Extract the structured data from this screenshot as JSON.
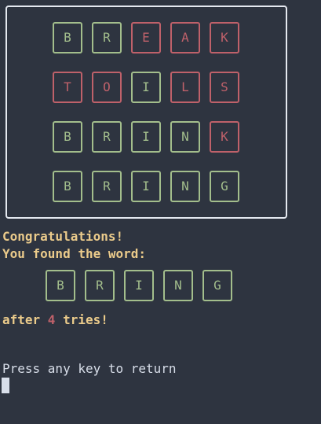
{
  "board": {
    "rows": [
      {
        "letters": [
          {
            "ch": "B",
            "state": "ok"
          },
          {
            "ch": "R",
            "state": "ok"
          },
          {
            "ch": "E",
            "state": "wrong"
          },
          {
            "ch": "A",
            "state": "wrong"
          },
          {
            "ch": "K",
            "state": "wrong"
          }
        ]
      },
      {
        "letters": [
          {
            "ch": "T",
            "state": "wrong"
          },
          {
            "ch": "O",
            "state": "wrong"
          },
          {
            "ch": "I",
            "state": "ok"
          },
          {
            "ch": "L",
            "state": "wrong"
          },
          {
            "ch": "S",
            "state": "wrong"
          }
        ]
      },
      {
        "letters": [
          {
            "ch": "B",
            "state": "ok"
          },
          {
            "ch": "R",
            "state": "ok"
          },
          {
            "ch": "I",
            "state": "ok"
          },
          {
            "ch": "N",
            "state": "ok"
          },
          {
            "ch": "K",
            "state": "wrong"
          }
        ]
      },
      {
        "letters": [
          {
            "ch": "B",
            "state": "ok"
          },
          {
            "ch": "R",
            "state": "ok"
          },
          {
            "ch": "I",
            "state": "ok"
          },
          {
            "ch": "N",
            "state": "ok"
          },
          {
            "ch": "G",
            "state": "ok"
          }
        ]
      }
    ]
  },
  "result": {
    "congrats": "Congratulations!",
    "found": "You found the word:",
    "word": [
      "B",
      "R",
      "I",
      "N",
      "G"
    ],
    "after_prefix": "after ",
    "tries_count": "4",
    "after_suffix": " tries!"
  },
  "footer": {
    "prompt": "Press any key to return"
  },
  "colors": {
    "background": "#2e3440",
    "correct": "#a3be8c",
    "wrong": "#bf616a",
    "message": "#ebcb8b",
    "text": "#d8dee9"
  }
}
